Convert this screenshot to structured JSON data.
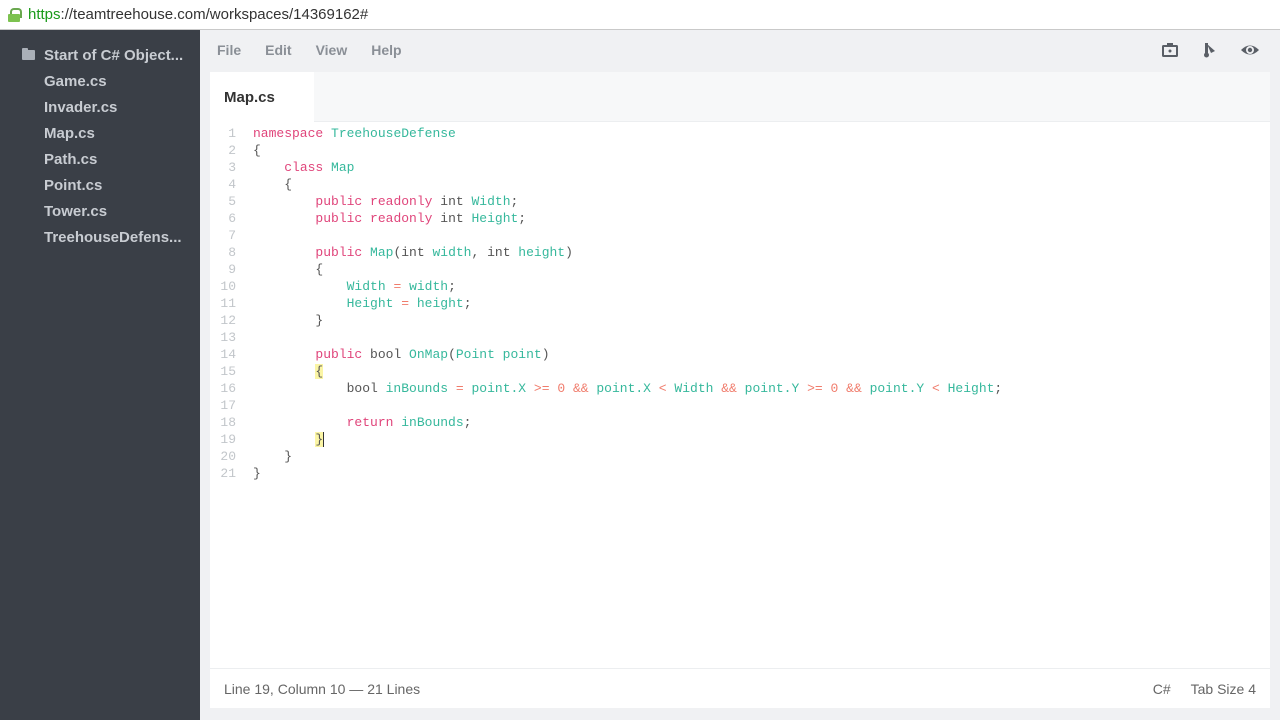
{
  "browser": {
    "url_scheme": "https",
    "url_rest": "://teamtreehouse.com/workspaces/14369162#"
  },
  "sidebar": {
    "folder": "Start of C# Object...",
    "files": [
      "Game.cs",
      "Invader.cs",
      "Map.cs",
      "Path.cs",
      "Point.cs",
      "Tower.cs",
      "TreehouseDefens..."
    ]
  },
  "menu": [
    "File",
    "Edit",
    "View",
    "Help"
  ],
  "toolbar_icons": [
    "snapshot-icon",
    "fork-icon",
    "preview-eye-icon"
  ],
  "tab": {
    "label": "Map.cs"
  },
  "code": [
    [
      [
        "namespace",
        "k"
      ],
      [
        " ",
        "p"
      ],
      [
        "TreehouseDefense",
        "t"
      ]
    ],
    [
      [
        "{",
        "p"
      ]
    ],
    [
      [
        "    ",
        "p"
      ],
      [
        "class",
        "k"
      ],
      [
        " ",
        "p"
      ],
      [
        "Map",
        "t"
      ]
    ],
    [
      [
        "    {",
        "p"
      ]
    ],
    [
      [
        "        ",
        "p"
      ],
      [
        "public",
        "k"
      ],
      [
        " ",
        "p"
      ],
      [
        "readonly",
        "k"
      ],
      [
        " int ",
        "p"
      ],
      [
        "Width",
        "t"
      ],
      [
        ";",
        "p"
      ]
    ],
    [
      [
        "        ",
        "p"
      ],
      [
        "public",
        "k"
      ],
      [
        " ",
        "p"
      ],
      [
        "readonly",
        "k"
      ],
      [
        " int ",
        "p"
      ],
      [
        "Height",
        "t"
      ],
      [
        ";",
        "p"
      ]
    ],
    [],
    [
      [
        "        ",
        "p"
      ],
      [
        "public",
        "k"
      ],
      [
        " ",
        "p"
      ],
      [
        "Map",
        "t"
      ],
      [
        "(int ",
        "p"
      ],
      [
        "width",
        "t"
      ],
      [
        ", int ",
        "p"
      ],
      [
        "height",
        "t"
      ],
      [
        ")",
        "p"
      ]
    ],
    [
      [
        "        {",
        "p"
      ]
    ],
    [
      [
        "            ",
        "p"
      ],
      [
        "Width",
        "t"
      ],
      [
        " ",
        "p"
      ],
      [
        "=",
        "o"
      ],
      [
        " ",
        "p"
      ],
      [
        "width",
        "t"
      ],
      [
        ";",
        "p"
      ]
    ],
    [
      [
        "            ",
        "p"
      ],
      [
        "Height",
        "t"
      ],
      [
        " ",
        "p"
      ],
      [
        "=",
        "o"
      ],
      [
        " ",
        "p"
      ],
      [
        "height",
        "t"
      ],
      [
        ";",
        "p"
      ]
    ],
    [
      [
        "        }",
        "p"
      ]
    ],
    [],
    [
      [
        "        ",
        "p"
      ],
      [
        "public",
        "k"
      ],
      [
        " bool ",
        "p"
      ],
      [
        "OnMap",
        "t"
      ],
      [
        "(",
        "p"
      ],
      [
        "Point point",
        "t"
      ],
      [
        ")",
        "p"
      ]
    ],
    [
      [
        "        ",
        "p"
      ],
      [
        "{",
        "p hl"
      ]
    ],
    [
      [
        "            bool ",
        "p"
      ],
      [
        "inBounds",
        "t"
      ],
      [
        " ",
        "p"
      ],
      [
        "=",
        "o"
      ],
      [
        " ",
        "p"
      ],
      [
        "point.X",
        "t"
      ],
      [
        " ",
        "p"
      ],
      [
        ">=",
        "o"
      ],
      [
        " ",
        "p"
      ],
      [
        "0",
        "o"
      ],
      [
        " ",
        "p"
      ],
      [
        "&&",
        "o"
      ],
      [
        " ",
        "p"
      ],
      [
        "point.X",
        "t"
      ],
      [
        " ",
        "p"
      ],
      [
        "<",
        "o"
      ],
      [
        " ",
        "p"
      ],
      [
        "Width",
        "t"
      ],
      [
        " ",
        "p"
      ],
      [
        "&&",
        "o"
      ],
      [
        " ",
        "p"
      ],
      [
        "point.Y",
        "t"
      ],
      [
        " ",
        "p"
      ],
      [
        ">=",
        "o"
      ],
      [
        " ",
        "p"
      ],
      [
        "0",
        "o"
      ],
      [
        " ",
        "p"
      ],
      [
        "&&",
        "o"
      ],
      [
        " ",
        "p"
      ],
      [
        "point.Y",
        "t"
      ],
      [
        " ",
        "p"
      ],
      [
        "<",
        "o"
      ],
      [
        " ",
        "p"
      ],
      [
        "Height",
        "t"
      ],
      [
        ";",
        "p"
      ]
    ],
    [],
    [
      [
        "            ",
        "p"
      ],
      [
        "return",
        "k"
      ],
      [
        " ",
        "p"
      ],
      [
        "inBounds",
        "t"
      ],
      [
        ";",
        "p"
      ]
    ],
    [
      [
        "        ",
        "p"
      ],
      [
        "}",
        "p hl"
      ],
      [
        "",
        "cursor"
      ]
    ],
    [
      [
        "    }",
        "p"
      ]
    ],
    [
      [
        "}",
        "p"
      ]
    ]
  ],
  "status": {
    "position": "Line 19, Column 10 — 21 Lines",
    "language": "C#",
    "tab_size": "Tab Size  4"
  }
}
